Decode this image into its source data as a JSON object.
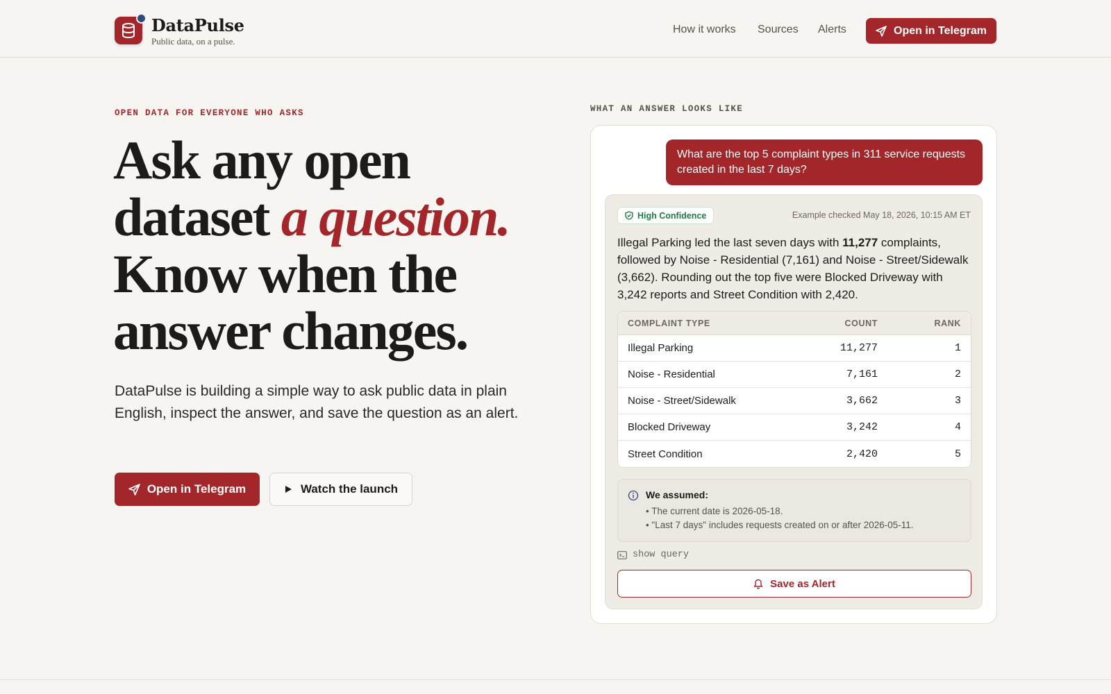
{
  "brand": {
    "name": "DataPulse",
    "tagline": "Public data, on a pulse."
  },
  "nav": {
    "links": [
      "How it works",
      "Sources",
      "Alerts"
    ],
    "cta": "Open in Telegram"
  },
  "hero": {
    "eyebrow": "OPEN DATA FOR EVERYONE WHO ASKS",
    "headline_part1": "Ask any open dataset ",
    "headline_accent": "a question.",
    "headline_part2": " Know when the answer changes.",
    "subhead": "DataPulse is building a simple way to ask public data in plain English, inspect the answer, and save the question as an alert.",
    "primary_cta": "Open in Telegram",
    "secondary_cta": "Watch the launch"
  },
  "example": {
    "label": "WHAT AN ANSWER LOOKS LIKE",
    "question": "What are the top 5 complaint types in 311 service requests created in the last 7 days?",
    "confidence": "High Confidence",
    "checked": "Example checked May 18, 2026, 10:15 AM ET",
    "answer_pre": "Illegal Parking led the last seven days with ",
    "answer_bold": "11,277",
    "answer_post": " complaints, followed by Noise - Residential (7,161) and Noise - Street/Sidewalk (3,662). Rounding out the top five were Blocked Driveway with 3,242 reports and Street Condition with 2,420.",
    "table": {
      "headers": [
        "COMPLAINT TYPE",
        "COUNT",
        "RANK"
      ],
      "rows": [
        [
          "Illegal Parking",
          "11,277",
          "1"
        ],
        [
          "Noise - Residential",
          "7,161",
          "2"
        ],
        [
          "Noise - Street/Sidewalk",
          "3,662",
          "3"
        ],
        [
          "Blocked Driveway",
          "3,242",
          "4"
        ],
        [
          "Street Condition",
          "2,420",
          "5"
        ]
      ]
    },
    "assumptions_title": "We assumed:",
    "assumptions": [
      "• The current date is 2026-05-18.",
      "• \"Last 7 days\" includes requests created on or after 2026-05-11."
    ],
    "show_query": "show query",
    "save_alert": "Save as Alert"
  },
  "colors": {
    "accent": "#a3262b",
    "background": "#f7f5f1",
    "confidence": "#1f7a45"
  },
  "icons": {
    "logo": "database-icon",
    "send": "send-icon",
    "play": "play-icon",
    "shield": "shield-check-icon",
    "info": "info-icon",
    "terminal": "terminal-icon",
    "bell": "bell-icon"
  }
}
